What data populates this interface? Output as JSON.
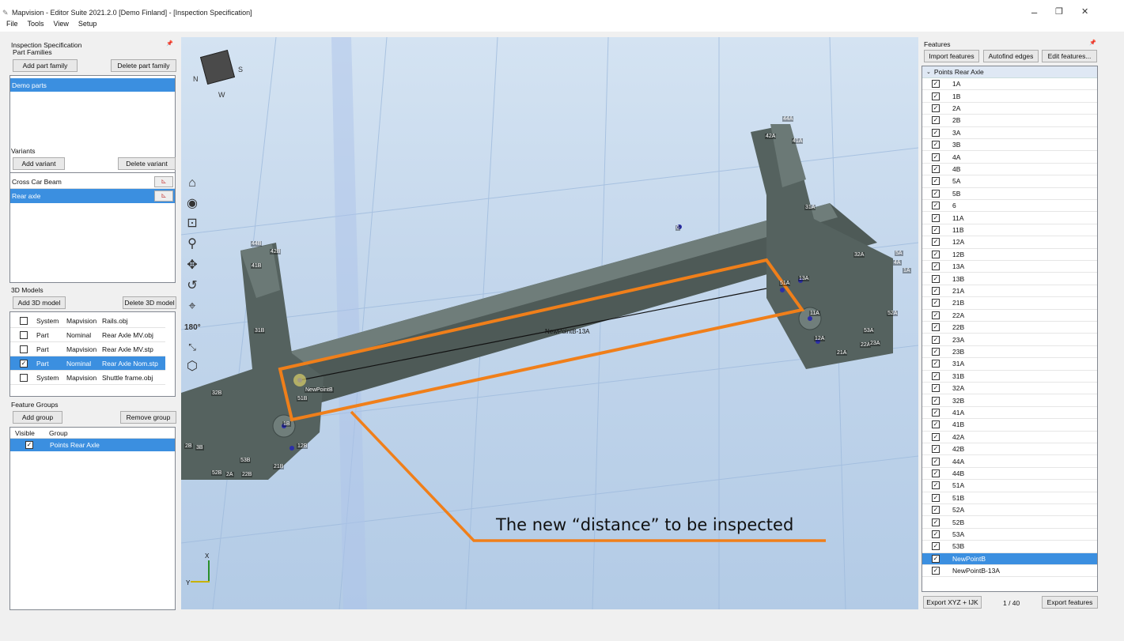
{
  "window": {
    "title": "Mapvision - Editor Suite 2021.2.0 [Demo Finland] - [Inspection Specification]",
    "minimize": "–",
    "maximize": "❐",
    "close": "✕"
  },
  "menu": [
    "File",
    "Tools",
    "View",
    "Setup"
  ],
  "left_panel": {
    "title": "Inspection Specification",
    "pin": "📌",
    "part_families": {
      "label": "Part Families",
      "add_btn": "Add part family",
      "delete_btn": "Delete part family",
      "items": [
        "Demo parts"
      ]
    },
    "variants": {
      "label": "Variants",
      "add_btn": "Add variant",
      "delete_btn": "Delete variant",
      "items": [
        "Cross Car Beam",
        "Rear axle"
      ]
    },
    "models": {
      "label": "3D Models",
      "add_btn": "Add 3D model",
      "delete_btn": "Delete 3D model",
      "rows": [
        {
          "checked": false,
          "type": "System",
          "source": "Mapvision",
          "file": "Rails.obj"
        },
        {
          "checked": false,
          "type": "Part",
          "source": "Nominal",
          "file": "Rear Axle MV.obj"
        },
        {
          "checked": false,
          "type": "Part",
          "source": "Mapvision",
          "file": "Rear Axle MV.stp"
        },
        {
          "checked": true,
          "type": "Part",
          "source": "Nominal",
          "file": "Rear Axle Nom.stp"
        },
        {
          "checked": false,
          "type": "System",
          "source": "Mapvision",
          "file": "Shuttle frame.obj"
        }
      ]
    },
    "feature_groups": {
      "label": "Feature Groups",
      "add_btn": "Add group",
      "remove_btn": "Remove group",
      "col_visible": "Visible",
      "col_group": "Group",
      "rows": [
        {
          "checked": true,
          "name": "Points Rear Axle"
        }
      ]
    }
  },
  "viewport": {
    "rotate_label": "180°",
    "annotation": "The new “distance” to be inspected",
    "distance_label": "NewPointB-13A",
    "point_labels": [
      "44A",
      "42A",
      "41A",
      "31A",
      "6",
      "32A",
      "5A",
      "4A",
      "1A",
      "51A",
      "13A",
      "11A",
      "52A",
      "53A",
      "12A",
      "22A",
      "21A",
      "23A",
      "44B",
      "42B",
      "41B",
      "31B",
      "NewPointB",
      "51B",
      "1B",
      "12B",
      "32B",
      "53B",
      "52B",
      "21B",
      "2B",
      "22B",
      "2A",
      "3B"
    ],
    "axes": {
      "x": "X",
      "y": "Y"
    }
  },
  "features_panel": {
    "title": "Features",
    "pin": "📌",
    "import_btn": "Import features",
    "autofind_btn": "Autofind edges",
    "edit_btn": "Edit features...",
    "group_name": "Points Rear Axle",
    "items": [
      "1A",
      "1B",
      "2A",
      "2B",
      "3A",
      "3B",
      "4A",
      "4B",
      "5A",
      "5B",
      "6",
      "11A",
      "11B",
      "12A",
      "12B",
      "13A",
      "13B",
      "21A",
      "21B",
      "22A",
      "22B",
      "23A",
      "23B",
      "31A",
      "31B",
      "32A",
      "32B",
      "41A",
      "41B",
      "42A",
      "42B",
      "44A",
      "44B",
      "51A",
      "51B",
      "52A",
      "52B",
      "53A",
      "53B",
      "NewPointB",
      "NewPointB-13A"
    ],
    "selected": "NewPointB",
    "export_xyz_btn": "Export XYZ + IJK",
    "page": "1 / 40",
    "export_btn": "Export features"
  },
  "colors": {
    "selection": "#3b8fe0",
    "highlight": "#f07f1a",
    "point": "#2c2fa8"
  }
}
